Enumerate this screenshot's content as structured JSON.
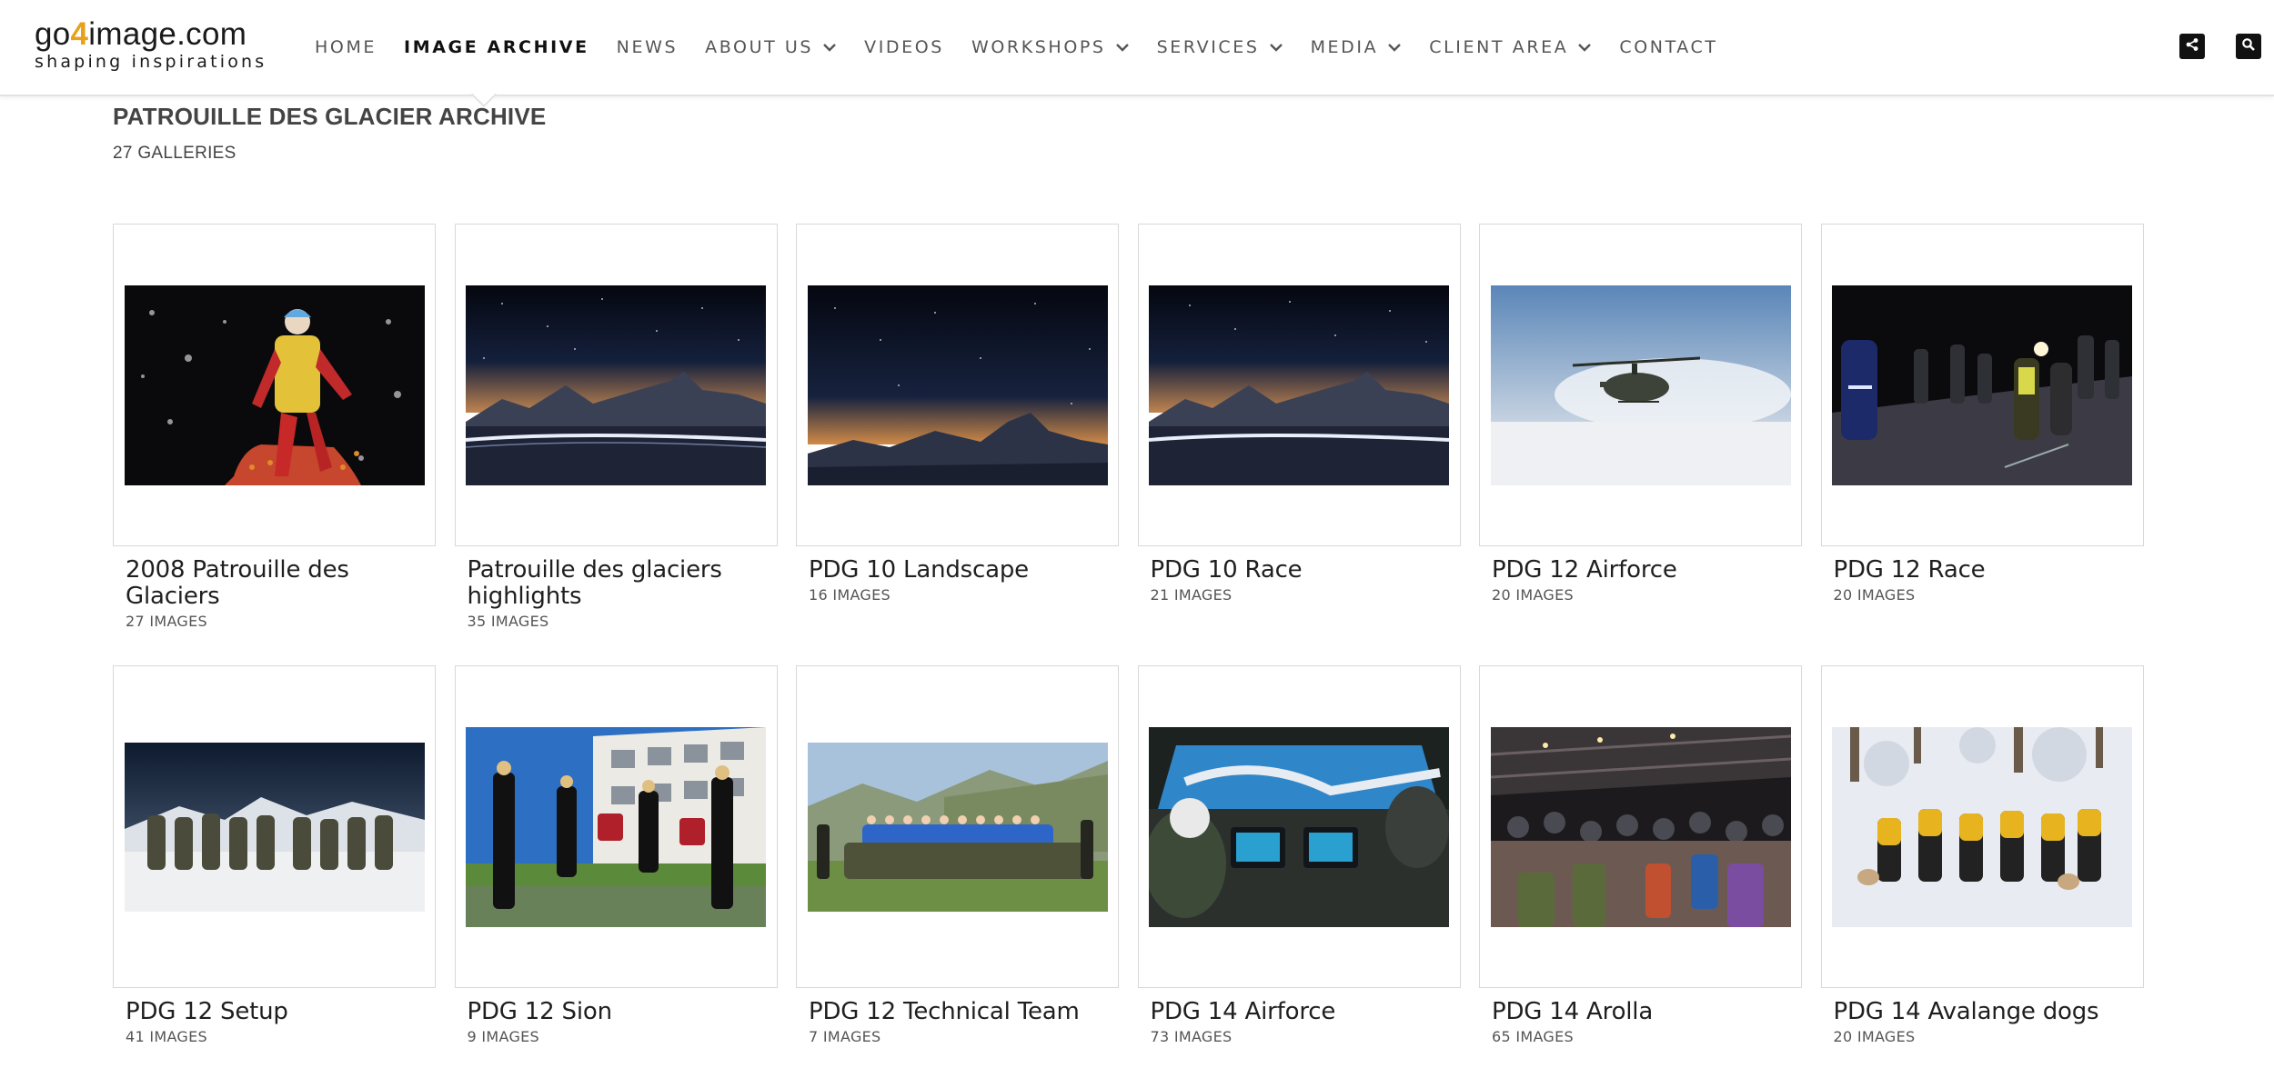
{
  "header": {
    "logo": {
      "part1": "go",
      "part2": "4",
      "part3": "image.com",
      "tagline": "shaping inspirations"
    },
    "nav": [
      {
        "label": "HOME",
        "dropdown": false,
        "active": false
      },
      {
        "label": "IMAGE ARCHIVE",
        "dropdown": false,
        "active": true
      },
      {
        "label": "NEWS",
        "dropdown": false,
        "active": false
      },
      {
        "label": "ABOUT US",
        "dropdown": true,
        "active": false
      },
      {
        "label": "VIDEOS",
        "dropdown": false,
        "active": false
      },
      {
        "label": "WORKSHOPS",
        "dropdown": true,
        "active": false
      },
      {
        "label": "SERVICES",
        "dropdown": true,
        "active": false
      },
      {
        "label": "MEDIA",
        "dropdown": true,
        "active": false
      },
      {
        "label": "CLIENT AREA",
        "dropdown": true,
        "active": false
      },
      {
        "label": "CONTACT",
        "dropdown": false,
        "active": false
      }
    ],
    "icons": {
      "share": "share-icon",
      "search": "search-icon"
    }
  },
  "page": {
    "title": "PATROUILLE DES GLACIER ARCHIVE",
    "gallery_count": "27 GALLERIES"
  },
  "galleries": [
    {
      "title": "2008 Patrouille des Glaciers",
      "count": "27 IMAGES",
      "scene": "skier-night"
    },
    {
      "title": "Patrouille des glaciers highlights",
      "count": "35 IMAGES",
      "scene": "night-mountains-trail"
    },
    {
      "title": "PDG 10 Landscape",
      "count": "16 IMAGES",
      "scene": "night-mountains"
    },
    {
      "title": "PDG 10 Race",
      "count": "21 IMAGES",
      "scene": "night-mountains-trail"
    },
    {
      "title": "PDG 12 Airforce",
      "count": "20 IMAGES",
      "scene": "helicopter-snow"
    },
    {
      "title": "PDG 12 Race",
      "count": "20 IMAGES",
      "scene": "night-skiers"
    },
    {
      "title": "PDG 12 Setup",
      "count": "41 IMAGES",
      "scene": "soldiers-snow"
    },
    {
      "title": "PDG 12 Sion",
      "count": "9 IMAGES",
      "scene": "brass-band"
    },
    {
      "title": "PDG 12 Technical Team",
      "count": "7 IMAGES",
      "scene": "team-group"
    },
    {
      "title": "PDG 14 Airforce",
      "count": "73 IMAGES",
      "scene": "cockpit"
    },
    {
      "title": "PDG 14 Arolla",
      "count": "65 IMAGES",
      "scene": "crowd-hall"
    },
    {
      "title": "PDG 14 Avalange dogs",
      "count": "20 IMAGES",
      "scene": "dogs-team"
    }
  ],
  "colors": {
    "logo_accent": "#e8a21a",
    "nav_text": "#555555",
    "nav_active": "#111111",
    "border": "#d8d8d8"
  }
}
